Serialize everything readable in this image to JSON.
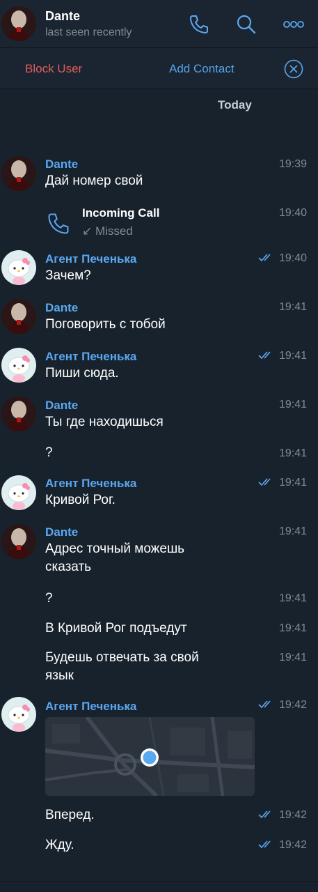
{
  "header": {
    "name": "Dante",
    "status": "last seen recently"
  },
  "actions": {
    "block": "Block User",
    "add": "Add Contact"
  },
  "date_label": "Today",
  "messages": [
    {
      "sender": "Dante",
      "text": "Дай номер свой",
      "time": "19:39"
    },
    {
      "call_title": "Incoming Call",
      "call_status": "↙ Missed",
      "time": "19:40"
    },
    {
      "sender": "Агент Печенька",
      "text": "Зачем?",
      "time": "19:40"
    },
    {
      "sender": "Dante",
      "text": "Поговорить с тобой",
      "time": "19:41"
    },
    {
      "sender": "Агент Печенька",
      "text": "Пиши сюда.",
      "time": "19:41"
    },
    {
      "sender": "Dante",
      "text": "Ты где находишься",
      "time": "19:41"
    },
    {
      "text": "?",
      "time": "19:41"
    },
    {
      "sender": "Агент Печенька",
      "text": "Кривой Рог.",
      "time": "19:41"
    },
    {
      "sender": "Dante",
      "text": "Адрес точный можешь\nсказать",
      "time": "19:41"
    },
    {
      "text": "?",
      "time": "19:41"
    },
    {
      "text": "В Кривой Рог подъедут",
      "time": "19:41"
    },
    {
      "text": "Будешь отвечать за свой\nязык",
      "time": "19:41"
    },
    {
      "sender": "Агент Печенька",
      "time": "19:42"
    },
    {
      "text": "Вперед.",
      "time": "19:42"
    },
    {
      "text": "Жду.",
      "time": "19:42"
    }
  ],
  "colors": {
    "background": "#18222d",
    "accent": "#5aa8f0",
    "danger": "#e35d5b",
    "muted": "#7f8b97"
  }
}
